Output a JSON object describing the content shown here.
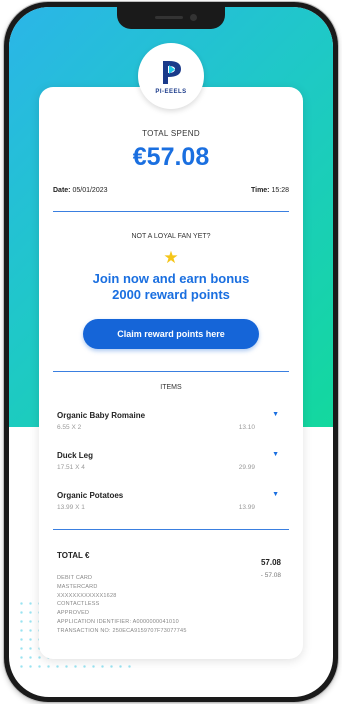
{
  "brand": {
    "name": "PI-EEELS"
  },
  "receipt": {
    "total_spend_label": "TOTAL SPEND",
    "total_spend_amount": "€57.08",
    "date_label": "Date:",
    "date_value": "05/01/2023",
    "time_label": "Time:",
    "time_value": "15:28"
  },
  "loyalty": {
    "prompt": "NOT A LOYAL FAN YET?",
    "headline_line1": "Join now and earn bonus",
    "headline_line2": "2000 reward points",
    "cta_label": "Claim reward points here"
  },
  "items": {
    "section_label": "ITEMS",
    "list": [
      {
        "name": "Organic Baby Romaine",
        "detail": "6.55 X 2",
        "price": "13.10"
      },
      {
        "name": "Duck Leg",
        "detail": "17.51 X 4",
        "price": "29.99"
      },
      {
        "name": "Organic Potatoes",
        "detail": "13.99 X 1",
        "price": "13.99"
      }
    ]
  },
  "totals": {
    "label": "TOTAL €",
    "value": "57.08",
    "payment": "- 57.08"
  },
  "transaction": {
    "line1": "DEBIT CARD",
    "line2": "MASTERCARD",
    "line3": "XXXXXXXXXXXX1628",
    "line4": "CONTACTLESS",
    "line5": "APPROVED",
    "line6": "APPLICATION IDENTIFIER: A0000000041010",
    "line7": "TRANSACTION NO: 250ECA9159707F73077745"
  },
  "colors": {
    "accent": "#1a6fe0",
    "button": "#1565d8",
    "star": "#f5c518",
    "gradient_start": "#2bb5e8",
    "gradient_end": "#13d89e"
  },
  "icons": {
    "logo": "pi-logo-icon",
    "star": "star-icon",
    "chevron": "chevron-down-icon"
  }
}
